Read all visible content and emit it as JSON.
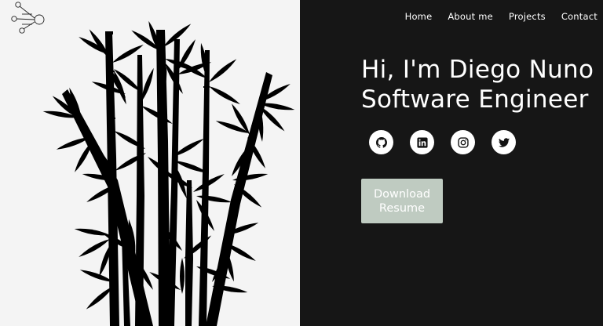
{
  "nav": {
    "items": [
      "Home",
      "About me",
      "Projects",
      "Contact"
    ]
  },
  "hero": {
    "line1": "Hi, I'm Diego Nuno",
    "line2": "Software Engineer"
  },
  "socials": [
    {
      "icon": "github-icon"
    },
    {
      "icon": "linkedin-icon"
    },
    {
      "icon": "instagram-icon"
    },
    {
      "icon": "twitter-icon"
    }
  ],
  "download": {
    "line1": "Download",
    "line2": "Resume"
  },
  "colors": {
    "left_bg": "#f4f4f4",
    "right_bg": "#161616",
    "button_bg": "#bfcbc1",
    "text": "#ffffff"
  }
}
